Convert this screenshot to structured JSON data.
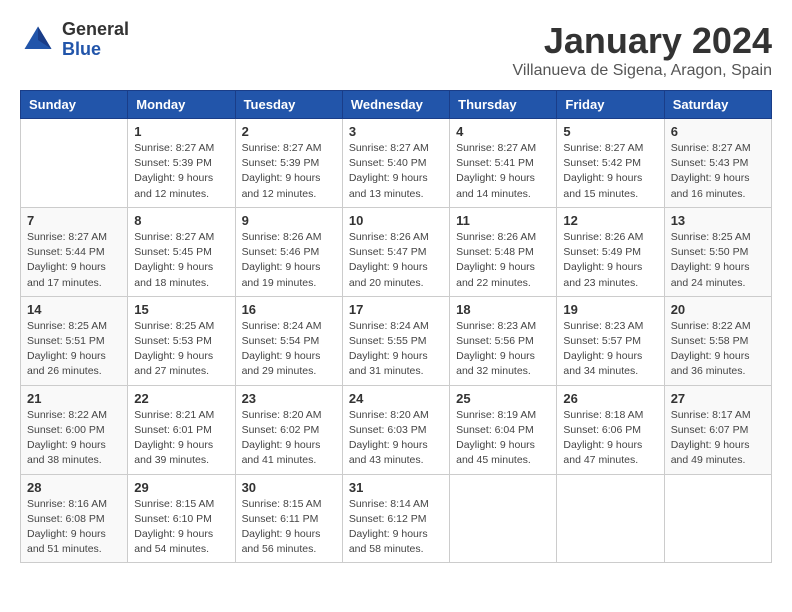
{
  "header": {
    "logo_general": "General",
    "logo_blue": "Blue",
    "month_year": "January 2024",
    "location": "Villanueva de Sigena, Aragon, Spain"
  },
  "weekdays": [
    "Sunday",
    "Monday",
    "Tuesday",
    "Wednesday",
    "Thursday",
    "Friday",
    "Saturday"
  ],
  "weeks": [
    [
      {
        "day": "",
        "info": ""
      },
      {
        "day": "1",
        "info": "Sunrise: 8:27 AM\nSunset: 5:39 PM\nDaylight: 9 hours\nand 12 minutes."
      },
      {
        "day": "2",
        "info": "Sunrise: 8:27 AM\nSunset: 5:39 PM\nDaylight: 9 hours\nand 12 minutes."
      },
      {
        "day": "3",
        "info": "Sunrise: 8:27 AM\nSunset: 5:40 PM\nDaylight: 9 hours\nand 13 minutes."
      },
      {
        "day": "4",
        "info": "Sunrise: 8:27 AM\nSunset: 5:41 PM\nDaylight: 9 hours\nand 14 minutes."
      },
      {
        "day": "5",
        "info": "Sunrise: 8:27 AM\nSunset: 5:42 PM\nDaylight: 9 hours\nand 15 minutes."
      },
      {
        "day": "6",
        "info": "Sunrise: 8:27 AM\nSunset: 5:43 PM\nDaylight: 9 hours\nand 16 minutes."
      }
    ],
    [
      {
        "day": "7",
        "info": "Sunrise: 8:27 AM\nSunset: 5:44 PM\nDaylight: 9 hours\nand 17 minutes."
      },
      {
        "day": "8",
        "info": "Sunrise: 8:27 AM\nSunset: 5:45 PM\nDaylight: 9 hours\nand 18 minutes."
      },
      {
        "day": "9",
        "info": "Sunrise: 8:26 AM\nSunset: 5:46 PM\nDaylight: 9 hours\nand 19 minutes."
      },
      {
        "day": "10",
        "info": "Sunrise: 8:26 AM\nSunset: 5:47 PM\nDaylight: 9 hours\nand 20 minutes."
      },
      {
        "day": "11",
        "info": "Sunrise: 8:26 AM\nSunset: 5:48 PM\nDaylight: 9 hours\nand 22 minutes."
      },
      {
        "day": "12",
        "info": "Sunrise: 8:26 AM\nSunset: 5:49 PM\nDaylight: 9 hours\nand 23 minutes."
      },
      {
        "day": "13",
        "info": "Sunrise: 8:25 AM\nSunset: 5:50 PM\nDaylight: 9 hours\nand 24 minutes."
      }
    ],
    [
      {
        "day": "14",
        "info": "Sunrise: 8:25 AM\nSunset: 5:51 PM\nDaylight: 9 hours\nand 26 minutes."
      },
      {
        "day": "15",
        "info": "Sunrise: 8:25 AM\nSunset: 5:53 PM\nDaylight: 9 hours\nand 27 minutes."
      },
      {
        "day": "16",
        "info": "Sunrise: 8:24 AM\nSunset: 5:54 PM\nDaylight: 9 hours\nand 29 minutes."
      },
      {
        "day": "17",
        "info": "Sunrise: 8:24 AM\nSunset: 5:55 PM\nDaylight: 9 hours\nand 31 minutes."
      },
      {
        "day": "18",
        "info": "Sunrise: 8:23 AM\nSunset: 5:56 PM\nDaylight: 9 hours\nand 32 minutes."
      },
      {
        "day": "19",
        "info": "Sunrise: 8:23 AM\nSunset: 5:57 PM\nDaylight: 9 hours\nand 34 minutes."
      },
      {
        "day": "20",
        "info": "Sunrise: 8:22 AM\nSunset: 5:58 PM\nDaylight: 9 hours\nand 36 minutes."
      }
    ],
    [
      {
        "day": "21",
        "info": "Sunrise: 8:22 AM\nSunset: 6:00 PM\nDaylight: 9 hours\nand 38 minutes."
      },
      {
        "day": "22",
        "info": "Sunrise: 8:21 AM\nSunset: 6:01 PM\nDaylight: 9 hours\nand 39 minutes."
      },
      {
        "day": "23",
        "info": "Sunrise: 8:20 AM\nSunset: 6:02 PM\nDaylight: 9 hours\nand 41 minutes."
      },
      {
        "day": "24",
        "info": "Sunrise: 8:20 AM\nSunset: 6:03 PM\nDaylight: 9 hours\nand 43 minutes."
      },
      {
        "day": "25",
        "info": "Sunrise: 8:19 AM\nSunset: 6:04 PM\nDaylight: 9 hours\nand 45 minutes."
      },
      {
        "day": "26",
        "info": "Sunrise: 8:18 AM\nSunset: 6:06 PM\nDaylight: 9 hours\nand 47 minutes."
      },
      {
        "day": "27",
        "info": "Sunrise: 8:17 AM\nSunset: 6:07 PM\nDaylight: 9 hours\nand 49 minutes."
      }
    ],
    [
      {
        "day": "28",
        "info": "Sunrise: 8:16 AM\nSunset: 6:08 PM\nDaylight: 9 hours\nand 51 minutes."
      },
      {
        "day": "29",
        "info": "Sunrise: 8:15 AM\nSunset: 6:10 PM\nDaylight: 9 hours\nand 54 minutes."
      },
      {
        "day": "30",
        "info": "Sunrise: 8:15 AM\nSunset: 6:11 PM\nDaylight: 9 hours\nand 56 minutes."
      },
      {
        "day": "31",
        "info": "Sunrise: 8:14 AM\nSunset: 6:12 PM\nDaylight: 9 hours\nand 58 minutes."
      },
      {
        "day": "",
        "info": ""
      },
      {
        "day": "",
        "info": ""
      },
      {
        "day": "",
        "info": ""
      }
    ]
  ]
}
